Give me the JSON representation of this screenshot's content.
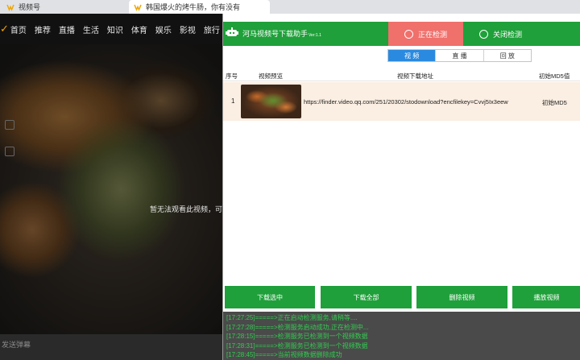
{
  "browser": {
    "tabs": [
      {
        "title": "视频号"
      },
      {
        "title": "韩国爆火的烤牛肠，你有没有"
      }
    ]
  },
  "site": {
    "nav": [
      "首页",
      "推荐",
      "直播",
      "生活",
      "知识",
      "体育",
      "娱乐",
      "影视",
      "旅行"
    ],
    "message": "暂无法观看此视频，可",
    "danmaku_placeholder": "发送弹幕"
  },
  "tool": {
    "title": "河马视频号下载助手",
    "version": "Ver:1.1",
    "detect_button": "正在检测",
    "stop_button": "关闭检测",
    "tabs": [
      "视 频",
      "直 播",
      "回 放"
    ],
    "active_tab": 0,
    "table": {
      "columns": [
        "序号",
        "视频预览",
        "视频下载地址",
        "初始MD5值"
      ],
      "rows": [
        {
          "index": "1",
          "url": "https://finder.video.qq.com/251/20302/stodownload?encfilekey=Cvvj5Ix3eew",
          "md5": "初始MD5"
        }
      ]
    },
    "actions": [
      "下载选中",
      "下载全部",
      "删除视频",
      "播放视频"
    ],
    "log": [
      "[17:27:25]=====>正在启动检测服务,请稍等....",
      "[17:27:28]=====>检测服务启动成功,正在检测中...",
      "[17:28:15]=====>检测服务已检测到一个视频数据",
      "[17:28:31]=====>检测服务已检测到一个视频数据",
      "[17:28:45]=====>当前视频数据删除成功"
    ],
    "colors": {
      "accent": "#1fa03a",
      "detecting": "#f0706c",
      "tab_active": "#2a8ae0",
      "log_text": "#2fce4f"
    }
  }
}
